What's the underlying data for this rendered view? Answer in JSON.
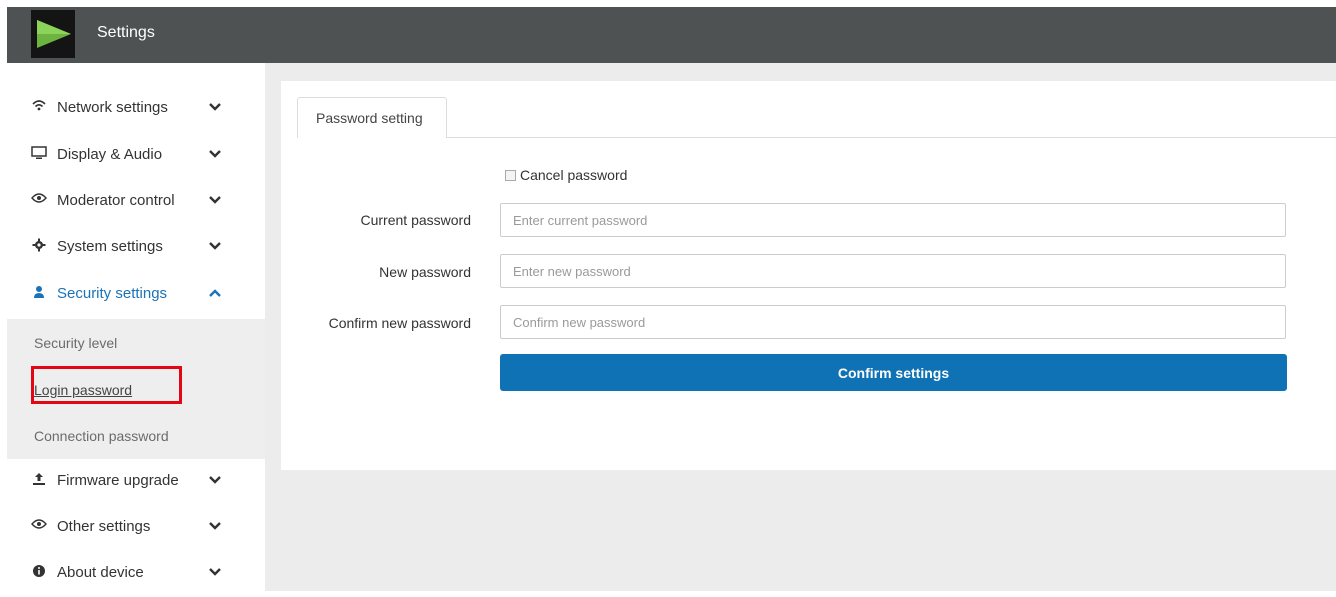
{
  "header": {
    "title": "Settings"
  },
  "sidebar": {
    "items": [
      {
        "label": "Network settings",
        "icon": "wifi-icon"
      },
      {
        "label": "Display & Audio",
        "icon": "monitor-icon"
      },
      {
        "label": "Moderator control",
        "icon": "eye-icon"
      },
      {
        "label": "System settings",
        "icon": "gear-icon"
      },
      {
        "label": "Security settings",
        "icon": "user-lock-icon"
      },
      {
        "label": "Firmware upgrade",
        "icon": "upload-icon"
      },
      {
        "label": "Other settings",
        "icon": "eye-icon"
      },
      {
        "label": "About device",
        "icon": "info-icon"
      }
    ],
    "security_submenu": [
      {
        "label": "Security level"
      },
      {
        "label": "Login password"
      },
      {
        "label": "Connection password"
      }
    ]
  },
  "main": {
    "tab_label": "Password setting",
    "cancel_password_label": "Cancel password",
    "current_password": {
      "label": "Current password",
      "placeholder": "Enter current password"
    },
    "new_password": {
      "label": "New password",
      "placeholder": "Enter new password"
    },
    "confirm_password": {
      "label": "Confirm new password",
      "placeholder": "Confirm new password"
    },
    "confirm_button": "Confirm settings"
  },
  "colors": {
    "topbar": "#4f5253",
    "accent": "#0f72b5",
    "highlight": "#e30613",
    "logo_green": "#6cb33f"
  }
}
